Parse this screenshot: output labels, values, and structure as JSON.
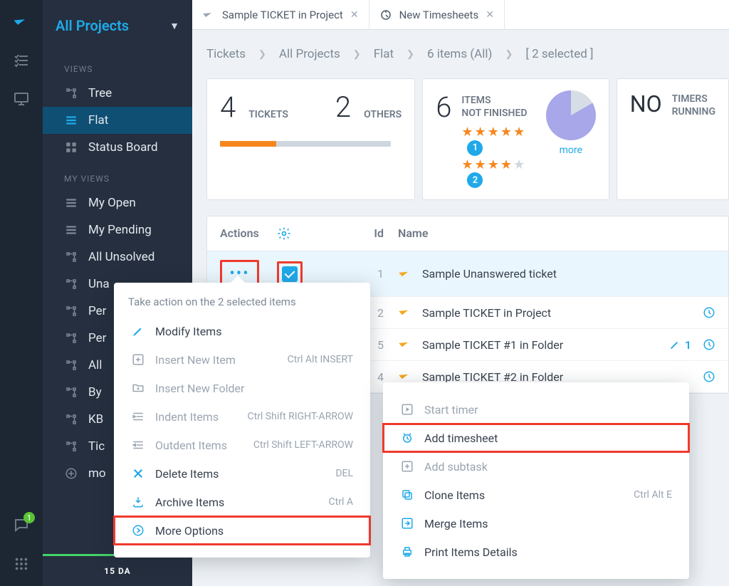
{
  "rail": {
    "chat_badge": "1"
  },
  "sidebar": {
    "title": "All Projects",
    "views_label": "VIEWS",
    "views": [
      {
        "label": "Tree"
      },
      {
        "label": "Flat"
      },
      {
        "label": "Status Board"
      }
    ],
    "myviews_label": "MY VIEWS",
    "myviews": [
      {
        "label": "My Open"
      },
      {
        "label": "My Pending"
      },
      {
        "label": "All Unsolved"
      },
      {
        "label": "Una"
      },
      {
        "label": "Per"
      },
      {
        "label": "Per"
      },
      {
        "label": "All"
      },
      {
        "label": "By"
      },
      {
        "label": "KB"
      },
      {
        "label": "Tic"
      },
      {
        "label": "mo"
      }
    ],
    "footer": "15 DA"
  },
  "tabs": [
    {
      "label": "Sample TICKET in Project"
    },
    {
      "label": "New Timesheets"
    }
  ],
  "crumbs": {
    "c1": "Tickets",
    "c2": "All Projects",
    "c3": "Flat",
    "c4": "6 items (All)",
    "c5": "[ 2 selected ]"
  },
  "cards": {
    "tickets_n": "4",
    "tickets_l": "TICKETS",
    "others_n": "2",
    "others_l": "OTHERS",
    "items_n": "6",
    "items_l1": "ITEMS",
    "items_l2": "NOT FINISHED",
    "rate1": "1",
    "rate2": "2",
    "more": "more",
    "no": "NO",
    "timers_l1": "TIMERS",
    "timers_l2": "RUNNING"
  },
  "table": {
    "h_actions": "Actions",
    "h_id": "Id",
    "h_name": "Name",
    "rows": [
      {
        "id": "1",
        "name": "Sample Unanswered ticket"
      },
      {
        "id": "2",
        "name": "Sample TICKET in Project"
      },
      {
        "id": "5",
        "name": "Sample TICKET #1 in Folder",
        "edit": "1"
      },
      {
        "id": "4",
        "name": "Sample TICKET #2 in Folder"
      }
    ]
  },
  "menu1": {
    "title": "Take action on the 2 selected items",
    "modify": "Modify Items",
    "insert_item": "Insert New Item",
    "insert_item_sc": "Ctrl Alt INSERT",
    "insert_folder": "Insert New Folder",
    "indent": "Indent Items",
    "indent_sc": "Ctrl Shift RIGHT-ARROW",
    "outdent": "Outdent Items",
    "outdent_sc": "Ctrl Shift LEFT-ARROW",
    "delete": "Delete Items",
    "delete_sc": "DEL",
    "archive": "Archive Items",
    "archive_sc": "Ctrl A",
    "more": "More Options"
  },
  "menu2": {
    "start_timer": "Start timer",
    "add_timesheet": "Add timesheet",
    "add_subtask": "Add subtask",
    "clone": "Clone Items",
    "clone_sc": "Ctrl Alt E",
    "merge": "Merge Items",
    "print": "Print Items Details"
  }
}
